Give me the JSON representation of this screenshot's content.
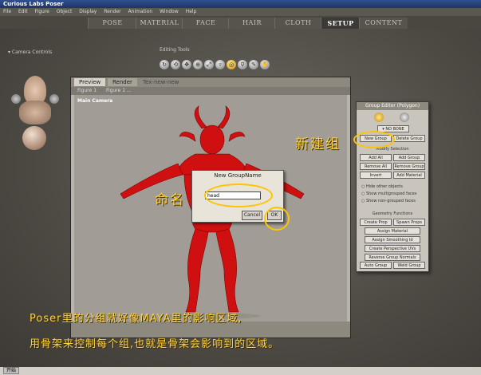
{
  "window": {
    "title": "Curious Labs Poser"
  },
  "menu": [
    "File",
    "Edit",
    "Figure",
    "Object",
    "Display",
    "Render",
    "Animation",
    "Window",
    "Help"
  ],
  "tabs": [
    "POSE",
    "MATERIAL",
    "FACE",
    "HAIR",
    "CLOTH",
    "SETUP",
    "CONTENT"
  ],
  "active_tab": "SETUP",
  "camera_controls": {
    "label": "Camera Controls"
  },
  "editing_tools": {
    "label": "Editing Tools"
  },
  "preview": {
    "tabs": [
      "Preview",
      "Render",
      "Tex-new-new"
    ],
    "figure_left": "Figure 1",
    "figure_right": "Figure 1 ...",
    "camera_name": "Main Camera"
  },
  "dialog": {
    "title": "New GroupName",
    "input_value": "head",
    "cancel_label": "Cancel",
    "ok_label": "OK"
  },
  "group_editor": {
    "title": "Group Editor (Polygon)",
    "selected": "NO BONE",
    "new_group": "New Group",
    "delete_group": "Delete Group",
    "modify_selection": "Modify Selection",
    "add_all": "Add All",
    "add_group": "Add Group",
    "remove_all": "Remove All",
    "remove_group": "Remove Group",
    "invert": "Invert",
    "add_material": "Add Material",
    "hide_other": "Hide other objects",
    "show_multi": "Show multigrouped faces",
    "show_non": "Show non-grouped faces",
    "geometry_functions": "Geometry Functions",
    "create_prop": "Create Prop",
    "spawn_props": "Spawn Props",
    "assign_material": "Assign Material",
    "assign_smoothing": "Assign Smoothing Id",
    "create_uvs": "Create Perspective UVs",
    "reverse_normals": "Reverse Group Normals",
    "auto_group": "Auto Group",
    "weld_group": "Weld Group"
  },
  "annotations": {
    "new_group_note": "新建组",
    "naming_note": "命名",
    "caption_line1": "Poser里的分组就好像MAYA里的影响区域,",
    "caption_line2": "用骨架来控制每个组,也就是骨架会影响到的区域。"
  },
  "taskbar": {
    "start": "开始"
  },
  "colors": {
    "annotation": "#ffd23a",
    "figure": "#d01010",
    "highlight_ring": "#ffc400"
  }
}
